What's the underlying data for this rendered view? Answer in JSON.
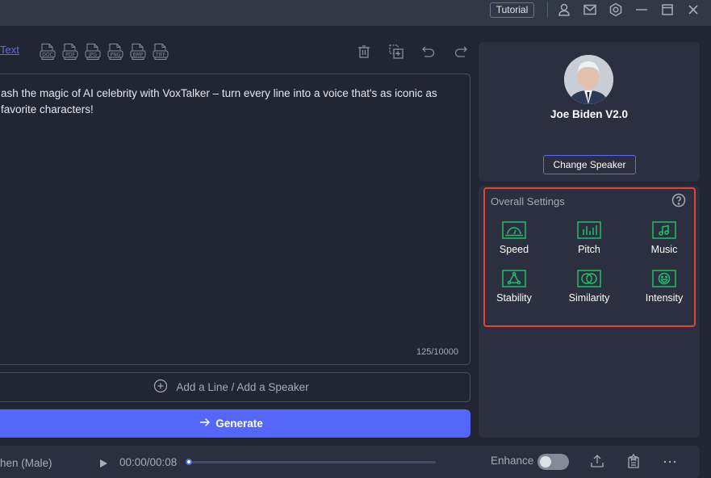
{
  "titlebar": {
    "tutorial_label": "Tutorial",
    "icons": [
      "user-icon",
      "mail-icon",
      "settings-icon",
      "minimize-icon",
      "maximize-icon",
      "close-icon"
    ]
  },
  "toolbar": {
    "text_link": "Text",
    "file_types": [
      "DOC",
      "PDF",
      "JPG",
      "PNG",
      "BMP",
      "TIFF"
    ],
    "actions": [
      "delete-icon",
      "add-copy-icon",
      "undo-icon",
      "redo-icon"
    ]
  },
  "editor": {
    "text": "ash the magic of AI celebrity with VoxTalker – turn every line into a voice that's as iconic as favorite characters!",
    "char_count": "125/10000"
  },
  "add_line": {
    "label": "Add a Line / Add a Speaker"
  },
  "generate": {
    "label": "Generate"
  },
  "speaker": {
    "name": "Joe Biden V2.0",
    "change_label": "Change Speaker"
  },
  "settings": {
    "title": "Overall Settings",
    "items": [
      {
        "label": "Speed",
        "icon": "speedometer-icon"
      },
      {
        "label": "Pitch",
        "icon": "pitch-bars-icon"
      },
      {
        "label": "Music",
        "icon": "music-note-icon"
      },
      {
        "label": "Stability",
        "icon": "stability-triangle-icon"
      },
      {
        "label": "Similarity",
        "icon": "similarity-circles-icon"
      },
      {
        "label": "Intensity",
        "icon": "intensity-face-icon"
      }
    ],
    "accent": "#1fbf6a",
    "highlight": "#e8432b"
  },
  "player": {
    "voice_name": "hen (Male)",
    "time": "00:00/00:08",
    "progress": 0.0,
    "enhance_label": "Enhance",
    "enhance_on": false
  },
  "colors": {
    "primary": "#5566fb",
    "background": "#222533",
    "panel": "#2b2f3f"
  }
}
